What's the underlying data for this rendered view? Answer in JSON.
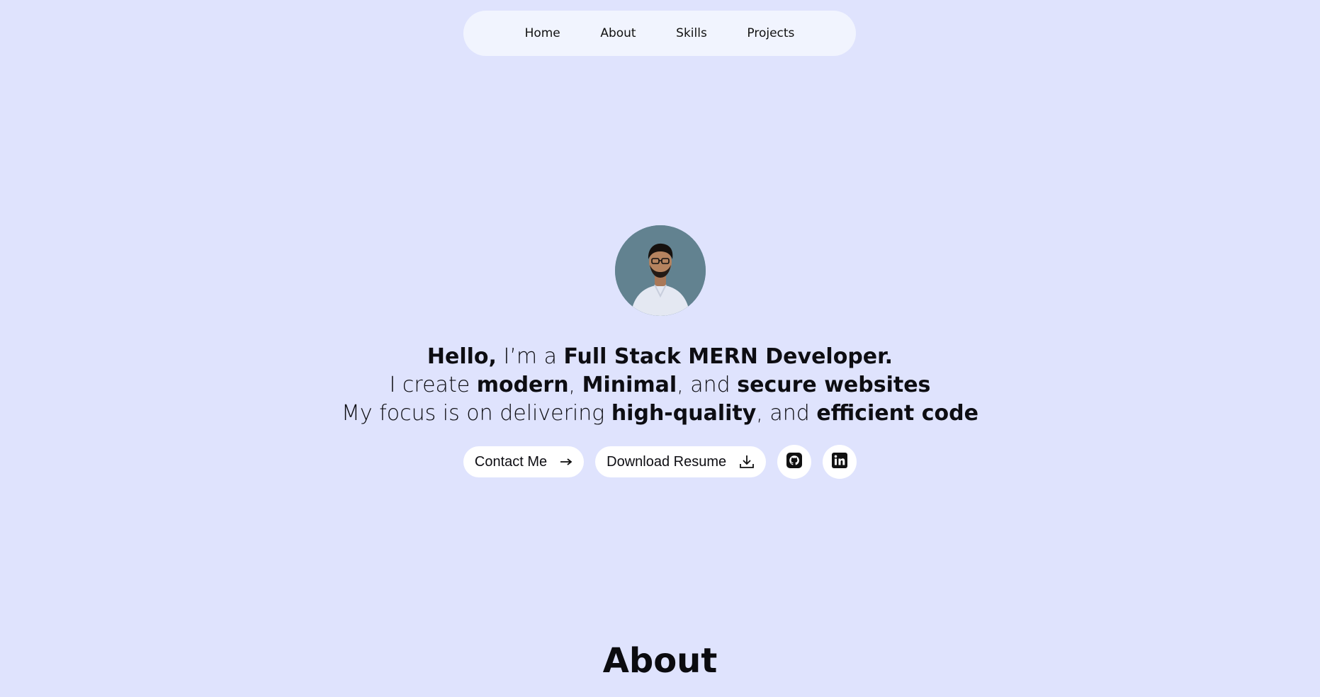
{
  "nav": {
    "items": [
      {
        "label": "Home"
      },
      {
        "label": "About"
      },
      {
        "label": "Skills"
      },
      {
        "label": "Projects"
      }
    ]
  },
  "hero": {
    "avatar_icon": "profile-photo",
    "line1": {
      "a": "Hello,",
      "b": " I’m a ",
      "c": "Full Stack MERN Developer."
    },
    "line2": {
      "a": "I create ",
      "b": "modern",
      "c": ", ",
      "d": "Minimal",
      "e": ", and ",
      "f": "secure websites"
    },
    "line3": {
      "a": "My focus is on delivering ",
      "b": "high-quality",
      "c": ", and ",
      "d": "efficient code"
    },
    "contact_label": "Contact Me",
    "contact_icon": "arrow-right-icon",
    "resume_label": "Download Resume",
    "resume_icon": "download-icon",
    "github_icon": "github-icon",
    "linkedin_icon": "linkedin-icon"
  },
  "about": {
    "title": "About"
  },
  "colors": {
    "background": "#dfe3fd",
    "nav_background": "#f1f4fe",
    "button_background": "#ffffff",
    "text": "#0d0d12"
  }
}
